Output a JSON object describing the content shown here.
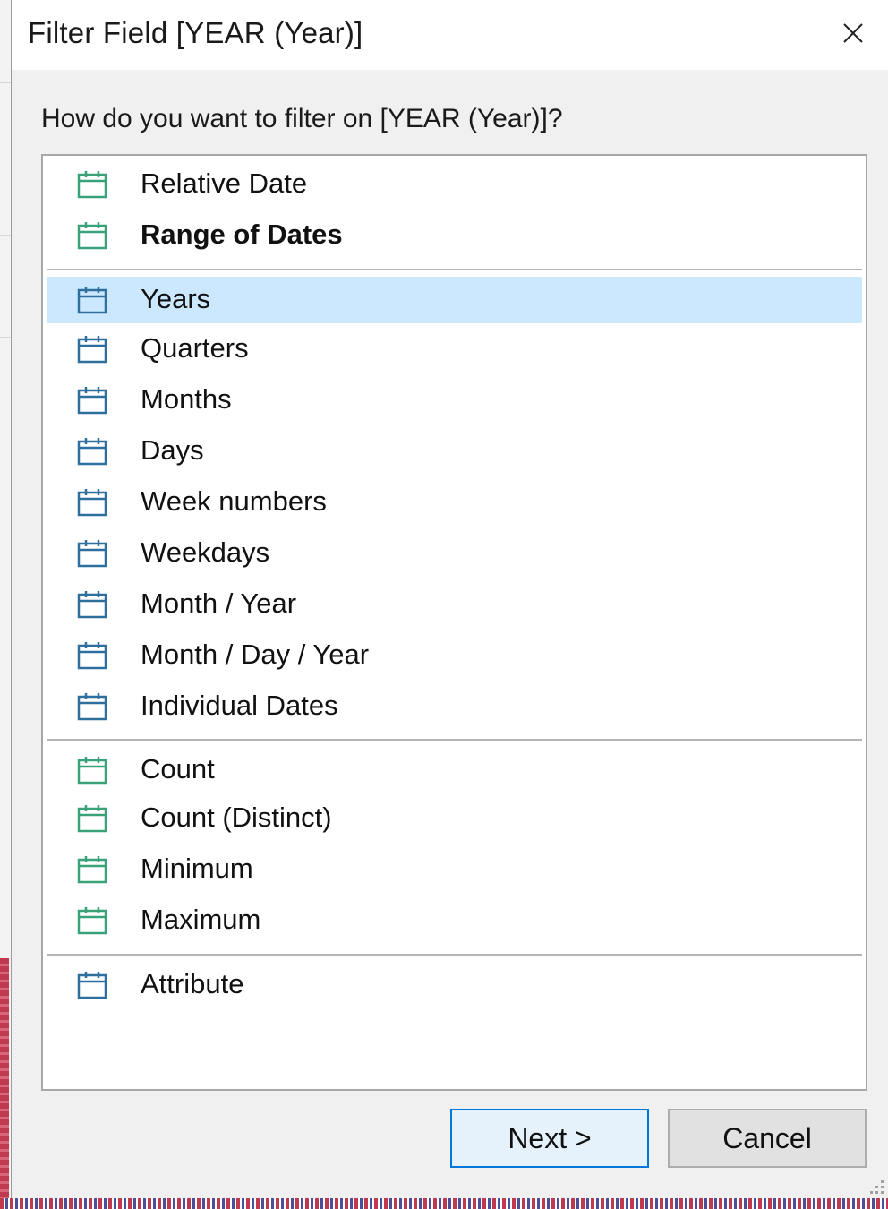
{
  "dialog": {
    "title": "Filter Field [YEAR (Year)]",
    "question": "How do you want to filter on [YEAR (Year)]?"
  },
  "colors": {
    "icon_green": "#3aa27a",
    "icon_blue": "#2e6f9e",
    "selection": "#cce8ff",
    "accent_border": "#0078d7"
  },
  "groups": [
    {
      "icon": "calendar-green-icon",
      "items": [
        {
          "label": "Relative Date",
          "bold": false,
          "selected": false
        },
        {
          "label": "Range of Dates",
          "bold": true,
          "selected": false
        }
      ]
    },
    {
      "icon": "calendar-blue-icon",
      "items": [
        {
          "label": "Years",
          "bold": false,
          "selected": true
        },
        {
          "label": "Quarters",
          "bold": false,
          "selected": false
        },
        {
          "label": "Months",
          "bold": false,
          "selected": false
        },
        {
          "label": "Days",
          "bold": false,
          "selected": false
        },
        {
          "label": "Week numbers",
          "bold": false,
          "selected": false
        },
        {
          "label": "Weekdays",
          "bold": false,
          "selected": false
        },
        {
          "label": "Month / Year",
          "bold": false,
          "selected": false
        },
        {
          "label": "Month / Day / Year",
          "bold": false,
          "selected": false
        },
        {
          "label": "Individual Dates",
          "bold": false,
          "selected": false
        }
      ]
    },
    {
      "icon": "calendar-green-icon",
      "items": [
        {
          "label": "Count",
          "bold": false,
          "selected": false
        },
        {
          "label": "Count (Distinct)",
          "bold": false,
          "selected": false
        },
        {
          "label": "Minimum",
          "bold": false,
          "selected": false
        },
        {
          "label": "Maximum",
          "bold": false,
          "selected": false
        }
      ]
    },
    {
      "icon": "calendar-blue-icon",
      "items": [
        {
          "label": "Attribute",
          "bold": false,
          "selected": false
        }
      ]
    }
  ],
  "buttons": {
    "next": "Next >",
    "cancel": "Cancel"
  }
}
